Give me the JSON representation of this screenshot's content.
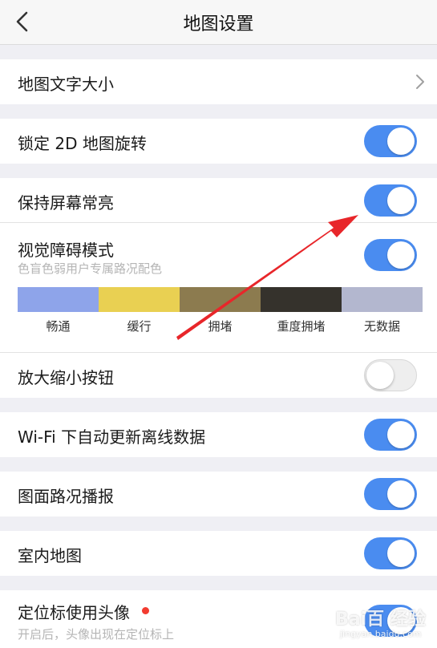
{
  "nav": {
    "title": "地图设置"
  },
  "settings": {
    "text_size": {
      "label": "地图文字大小"
    },
    "lock_rotation": {
      "label": "锁定 2D 地图旋转",
      "enabled": true
    },
    "keep_screen_on": {
      "label": "保持屏幕常亮",
      "enabled": true
    },
    "visual_impairment": {
      "label": "视觉障碍模式",
      "description": "色盲色弱用户专属路况配色",
      "enabled": true,
      "legend": [
        {
          "label": "畅通",
          "color": "#8ea4ea"
        },
        {
          "label": "缓行",
          "color": "#e9d052"
        },
        {
          "label": "拥堵",
          "color": "#8c7b4f"
        },
        {
          "label": "重度拥堵",
          "color": "#35322c"
        },
        {
          "label": "无数据",
          "color": "#b3b7cf"
        }
      ]
    },
    "zoom_buttons": {
      "label": "放大缩小按钮",
      "enabled": false
    },
    "wifi_offline_update": {
      "label": "Wi-Fi 下自动更新离线数据",
      "enabled": true
    },
    "traffic_broadcast": {
      "label": "图面路况播报",
      "enabled": true
    },
    "indoor_map": {
      "label": "室内地图",
      "enabled": true
    },
    "avatar_location": {
      "label": "定位标使用头像",
      "description": "开启后，头像出现在定位标上",
      "enabled": true
    }
  },
  "colors": {
    "toggle_on": "#4a8cf0",
    "accent_red": "#e8262a",
    "new_dot": "#f23b30"
  },
  "watermark": {
    "text": "Bai百 经验",
    "sub": "jingyan.baidu.com"
  }
}
